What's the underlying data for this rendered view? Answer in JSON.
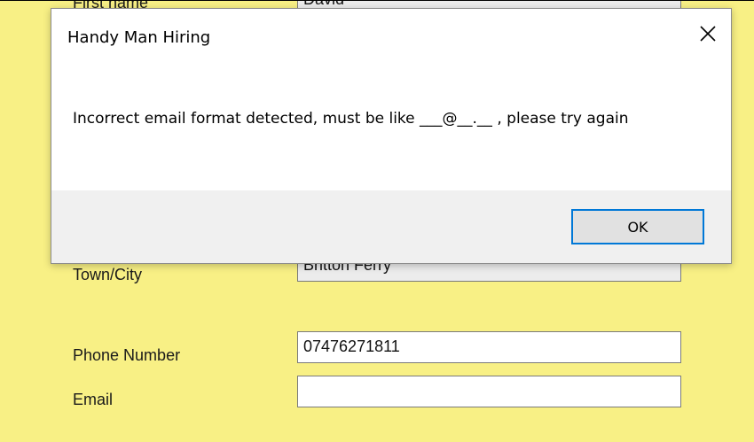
{
  "form": {
    "labels": {
      "first_name": "First name",
      "town_city": "Town/City",
      "phone_number": "Phone Number",
      "email": "Email"
    },
    "values": {
      "first_name": "David",
      "town_city": "Britton Ferry",
      "phone_number": "07476271811",
      "email": ""
    }
  },
  "dialog": {
    "title": "Handy Man Hiring",
    "message": "Incorrect email format detected, must be like ___@__.__ , please try again",
    "ok_label": "OK",
    "close_icon": "close-icon"
  },
  "colors": {
    "form_background": "#f8f085",
    "dialog_footer": "#f0f0f0",
    "button_focus_border": "#0078d7"
  }
}
